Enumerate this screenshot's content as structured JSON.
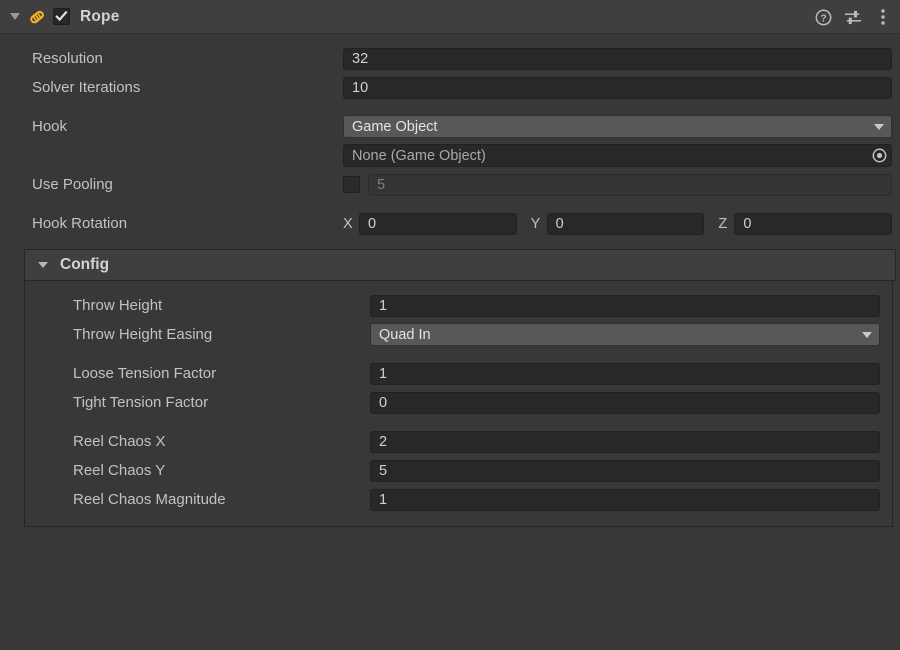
{
  "component": {
    "title": "Rope",
    "enabled": true,
    "foldout_expanded": true,
    "script_icon": "rope-script-icon",
    "header_icons": [
      {
        "name": "help-icon",
        "label": "?"
      },
      {
        "name": "preset-icon",
        "label": "Preset"
      },
      {
        "name": "more-menu-icon",
        "label": "More"
      }
    ]
  },
  "theme": {
    "window_bg": "#383838",
    "header_bg": "#3f3f3f",
    "field_bg": "#282828",
    "dropdown_bg": "#585858",
    "label_color": "#c2c2c2",
    "accent_icon": "#f5b223"
  },
  "properties": {
    "resolution": {
      "label": "Resolution",
      "value": "32"
    },
    "solver_iterations": {
      "label": "Solver Iterations",
      "value": "10"
    },
    "hook": {
      "label": "Hook",
      "type_value": "Game Object",
      "object_value": "None (Game Object)"
    },
    "use_pooling": {
      "label": "Use Pooling",
      "checked": false,
      "count_value": "5",
      "count_disabled": true
    },
    "hook_rotation": {
      "label": "Hook Rotation",
      "axes": [
        {
          "axis": "X",
          "value": "0"
        },
        {
          "axis": "Y",
          "value": "0"
        },
        {
          "axis": "Z",
          "value": "0"
        }
      ]
    }
  },
  "config": {
    "title": "Config",
    "expanded": true,
    "fields": {
      "throw_height": {
        "label": "Throw Height",
        "value": "1"
      },
      "throw_height_easing": {
        "label": "Throw Height Easing",
        "value": "Quad In"
      },
      "loose_tension_factor": {
        "label": "Loose Tension Factor",
        "value": "1"
      },
      "tight_tension_factor": {
        "label": "Tight Tension Factor",
        "value": "0"
      },
      "reel_chaos_x": {
        "label": "Reel Chaos X",
        "value": "2"
      },
      "reel_chaos_y": {
        "label": "Reel Chaos Y",
        "value": "5"
      },
      "reel_chaos_magnitude": {
        "label": "Reel Chaos Magnitude",
        "value": "1"
      }
    }
  }
}
